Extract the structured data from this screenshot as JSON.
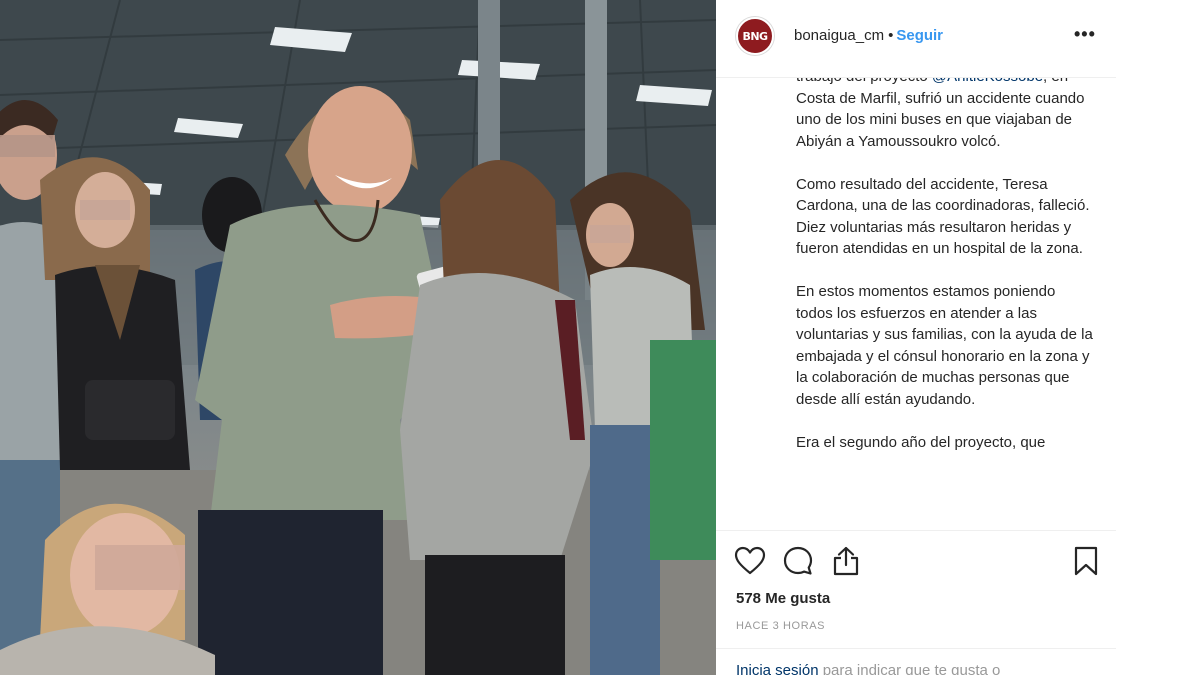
{
  "post": {
    "avatar_text": "BNG",
    "username": "bonaigua_cm",
    "separator": "•",
    "follow_label": "Seguir",
    "more_label": "•••"
  },
  "caption": {
    "p1_prefix": "trabajo del proyecto ",
    "p1_mention": "@AhitieKossobe",
    "p1_rest": ", en Costa de Marfil, sufrió un accidente cuando uno de los mini buses en que viajaban de Abiyán a Yamoussoukro volcó.",
    "p2": "Como resultado del accidente, Teresa Cardona, una de las coordinadoras, falleció. Diez voluntarias más resultaron heridas y fueron atendidas en un hospital de la zona.",
    "p3": "En estos momentos estamos poniendo todos los esfuerzos en atender a las voluntarias y sus familias, con la ayuda de la embajada y el cónsul honorario en la zona y la colaboración de muchas personas que desde allí están ayudando.",
    "p4": "Era el segundo año del proyecto, que"
  },
  "actions": {
    "icons": [
      "heart-icon",
      "comment-icon",
      "share-icon",
      "bookmark-icon"
    ]
  },
  "likes_text": "578 Me gusta",
  "timestamp": "HACE 3 HORAS",
  "login": {
    "link_label": "Inicia sesión",
    "rest": " para indicar que te gusta o"
  },
  "colors": {
    "follow": "#3897f0",
    "mention": "#003569",
    "avatar_bg": "#8e1b1f",
    "muted": "#999999",
    "text": "#262626"
  }
}
